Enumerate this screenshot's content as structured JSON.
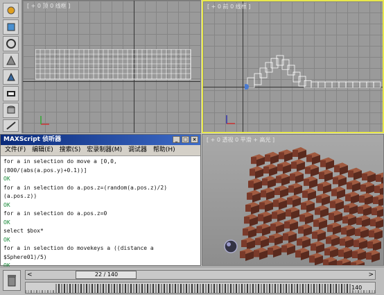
{
  "viewports": {
    "top": {
      "label": "[ + 0 顶 0 线框 ]"
    },
    "front": {
      "label": "[ + 0 前 0 线框 ]"
    },
    "perspective": {
      "label": "[ + 0 透视 0 平滑 + 高光 ]"
    }
  },
  "maxscript": {
    "title": "MAXScript 侦听器",
    "menu": [
      "文件(F)",
      "编辑(E)",
      "搜索(S)",
      "宏录制器(M)",
      "调试器",
      "帮助(H)"
    ],
    "lines": [
      "for a in selection do move a [0,0,(800/(abs(a.pos.y)+0.1))]",
      "OK",
      "for a in selection do a.pos.z=(random(a.pos.z)/2) (a.pos.z))",
      "OK",
      "for a in selection do a.pos.z=0",
      "OK",
      "select $box*",
      "OK",
      "for a in selection do movekeys a ((distance a $Sphere01)/5)",
      "OK"
    ]
  },
  "timeline": {
    "slider_text": "22 / 140",
    "end_frame_label": "140",
    "current_fraction": 0.157
  },
  "colors": {
    "ok_text": "#1a8a3a",
    "active_viewport_border": "#e8e84a",
    "box_face": "#7a3a2a"
  },
  "icons": [
    "create-icon",
    "modify-icon",
    "hierarchy-icon",
    "motion-icon",
    "display-icon",
    "utilities-icon",
    "camera-icon",
    "tape-icon"
  ]
}
